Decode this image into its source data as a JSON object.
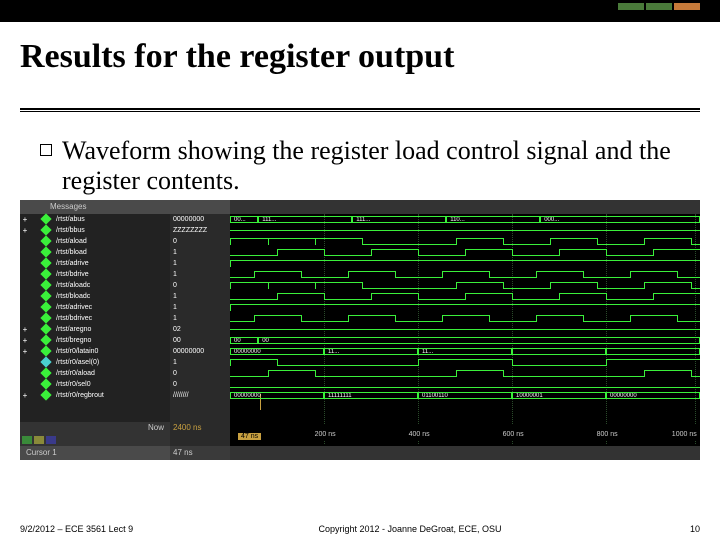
{
  "slide": {
    "title": "Results for the register output",
    "bullet1": "Waveform showing the register load control signal and the register contents."
  },
  "waveform": {
    "header_label": "Messages",
    "signals": [
      {
        "name": "/rtst/abus",
        "exp": "+",
        "color": "green",
        "val": "00000000"
      },
      {
        "name": "/rtst/bbus",
        "exp": "+",
        "color": "green",
        "val": "ZZZZZZZZ"
      },
      {
        "name": "/rtst/aload",
        "exp": "",
        "color": "green",
        "val": "0"
      },
      {
        "name": "/rtst/bload",
        "exp": "",
        "color": "green",
        "val": "1"
      },
      {
        "name": "/rtst/adrive",
        "exp": "",
        "color": "green",
        "val": "1"
      },
      {
        "name": "/rtst/bdrive",
        "exp": "",
        "color": "green",
        "val": "1"
      },
      {
        "name": "/rtst/aloadc",
        "exp": "",
        "color": "green",
        "val": "0"
      },
      {
        "name": "/rtst/bloadc",
        "exp": "",
        "color": "green",
        "val": "1"
      },
      {
        "name": "/rtst/adrivec",
        "exp": "",
        "color": "green",
        "val": "1"
      },
      {
        "name": "/rtst/bdrivec",
        "exp": "",
        "color": "green",
        "val": "1"
      },
      {
        "name": "/rtst/aregno",
        "exp": "+",
        "color": "green",
        "val": "02"
      },
      {
        "name": "/rtst/bregno",
        "exp": "+",
        "color": "green",
        "val": "00"
      },
      {
        "name": "/rtst/r0/latain0",
        "exp": "+",
        "color": "green",
        "val": "00000000"
      },
      {
        "name": "/rtst/r0/asel(0)",
        "exp": "",
        "color": "cyan",
        "val": "1"
      },
      {
        "name": "/rtst/r0/aload",
        "exp": "",
        "color": "green",
        "val": "0"
      },
      {
        "name": "/rtst/r0/sel0",
        "exp": "",
        "color": "green",
        "val": "0"
      },
      {
        "name": "/rtst/r0/regbrout",
        "exp": "+",
        "color": "green",
        "val": "////////"
      }
    ],
    "now_label": "Now",
    "now_value": "2400 ns",
    "cursor_label": "Cursor 1",
    "cursor_value": "47 ns",
    "cursor_tag": "47 ns",
    "time_ticks": [
      "200 ns",
      "400 ns",
      "600 ns",
      "800 ns",
      "1000 ns"
    ],
    "bus_labels": {
      "abus": [
        "00...",
        "111...",
        "111...",
        "110...",
        "000..."
      ],
      "bregno": [
        "00",
        "00"
      ],
      "latain": [
        "00000000",
        "11...",
        "11...",
        "",
        ""
      ],
      "regbrout": [
        "00000000",
        "11111111",
        "01100110",
        "10000001",
        "00000000"
      ]
    }
  },
  "footer": {
    "left": "9/2/2012 – ECE 3561 Lect 9",
    "mid": "Copyright 2012 - Joanne DeGroat, ECE, OSU",
    "right": "10"
  }
}
